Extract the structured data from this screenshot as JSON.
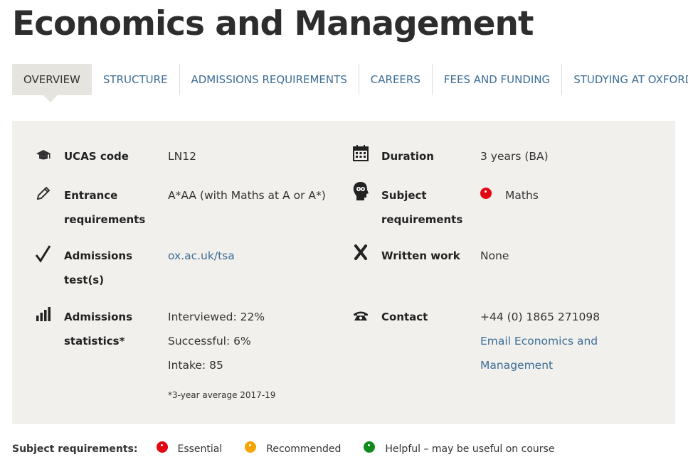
{
  "page": {
    "title": "Economics and Management"
  },
  "tabs": [
    {
      "label": "OVERVIEW",
      "active": true
    },
    {
      "label": "STRUCTURE"
    },
    {
      "label": "ADMISSIONS REQUIREMENTS"
    },
    {
      "label": "CAREERS"
    },
    {
      "label": "FEES AND FUNDING"
    },
    {
      "label": "STUDYING AT OXFORD"
    }
  ],
  "overview": {
    "ucas": {
      "icon": "graduation-cap-icon",
      "label": "UCAS code",
      "value": "LN12"
    },
    "entrance": {
      "icon": "pencil-icon",
      "label_line1": "Entrance",
      "label_line2": "requirements",
      "value": "A*AA (with Maths at A or A*)"
    },
    "admissions_test": {
      "icon": "checkmark-icon",
      "label_line1": "Admissions",
      "label_line2": "test(s)",
      "value": "ox.ac.uk/tsa"
    },
    "statistics": {
      "icon": "bar-chart-icon",
      "label_line1": "Admissions",
      "label_line2": "statistics*",
      "interviewed": "Interviewed: 22%",
      "successful": "Successful: 6%",
      "intake": "Intake: 85",
      "footnote": "*3-year average 2017-19"
    },
    "duration": {
      "icon": "calendar-icon",
      "label": "Duration",
      "value": "3 years (BA)"
    },
    "subject": {
      "icon": "head-icon",
      "label_line1": "Subject",
      "label_line2": "requirements",
      "value": "Maths",
      "level": "essential"
    },
    "written_work": {
      "icon": "cross-icon",
      "label": "Written work",
      "value": "None"
    },
    "contact": {
      "icon": "telephone-icon",
      "label": "Contact",
      "phone": "+44 (0) 1865 271098",
      "email_line1": "Email Economics and",
      "email_line2": "Management"
    }
  },
  "legend": {
    "title": "Subject requirements:",
    "items": [
      {
        "label": "Essential",
        "color": "#e30613"
      },
      {
        "label": "Recommended",
        "color": "#f5a400"
      },
      {
        "label": "Helpful – may be useful on course",
        "color": "#118a1c"
      }
    ]
  }
}
